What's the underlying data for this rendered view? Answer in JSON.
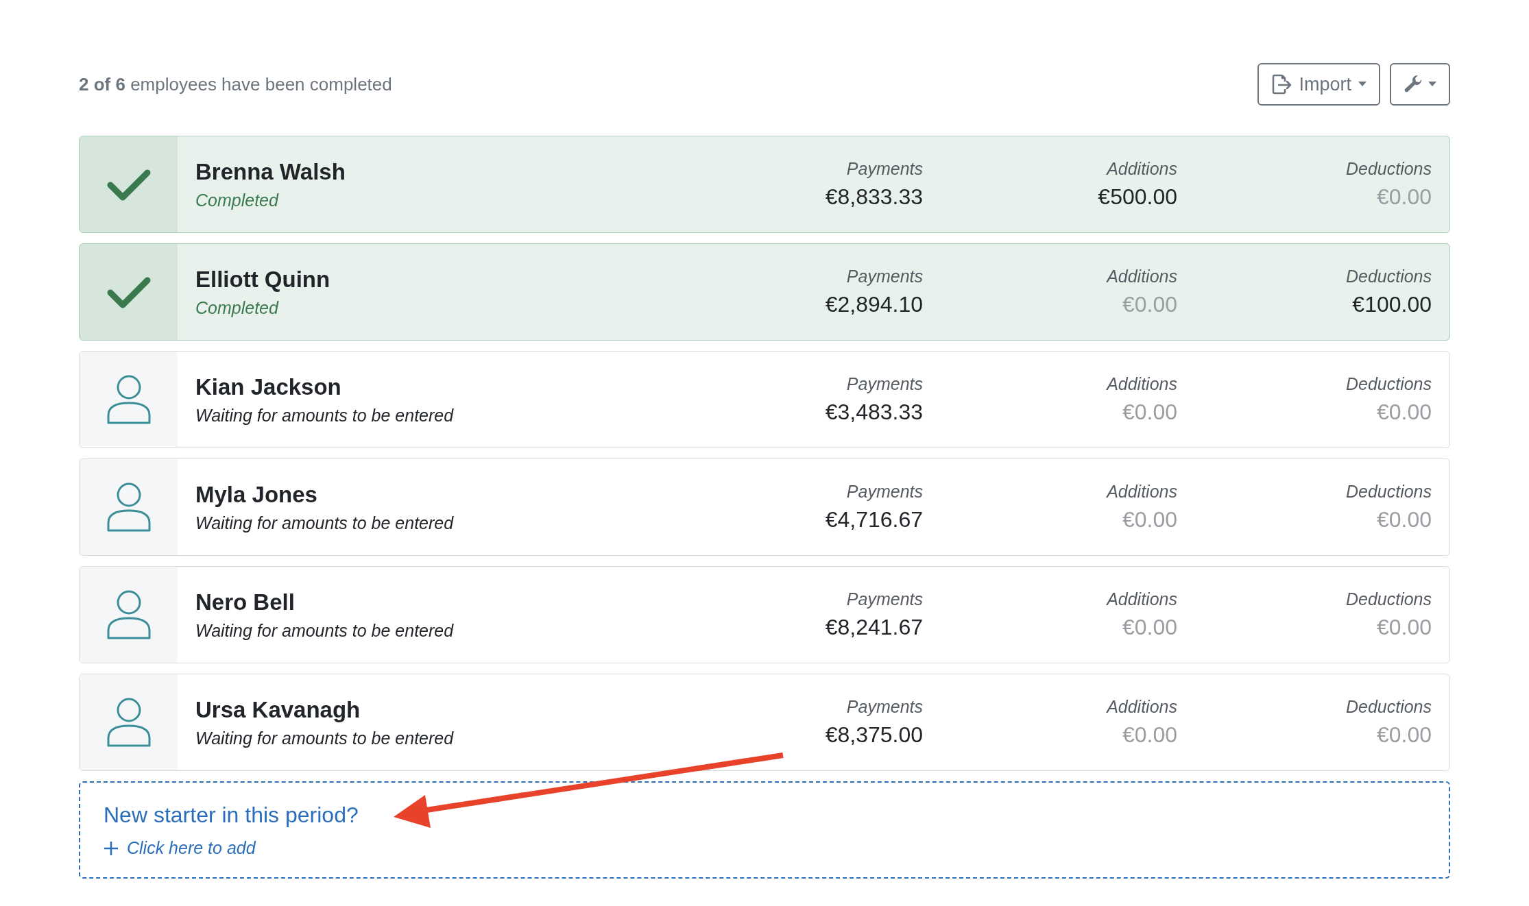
{
  "summary": {
    "count": "2 of 6",
    "text": "employees have been completed"
  },
  "toolbar": {
    "import_label": "Import"
  },
  "employees": [
    {
      "name": "Brenna Walsh",
      "completed": true,
      "status": "Completed",
      "amounts": [
        {
          "label": "Payments",
          "value": "€8,833.33",
          "dimmed": false
        },
        {
          "label": "Additions",
          "value": "€500.00",
          "dimmed": false
        },
        {
          "label": "Deductions",
          "value": "€0.00",
          "dimmed": true
        }
      ]
    },
    {
      "name": "Elliott Quinn",
      "completed": true,
      "status": "Completed",
      "amounts": [
        {
          "label": "Payments",
          "value": "€2,894.10",
          "dimmed": false
        },
        {
          "label": "Additions",
          "value": "€0.00",
          "dimmed": true
        },
        {
          "label": "Deductions",
          "value": "€100.00",
          "dimmed": false
        }
      ]
    },
    {
      "name": "Kian Jackson",
      "completed": false,
      "status": "Waiting for amounts to be entered",
      "amounts": [
        {
          "label": "Payments",
          "value": "€3,483.33",
          "dimmed": false
        },
        {
          "label": "Additions",
          "value": "€0.00",
          "dimmed": true
        },
        {
          "label": "Deductions",
          "value": "€0.00",
          "dimmed": true
        }
      ]
    },
    {
      "name": "Myla Jones",
      "completed": false,
      "status": "Waiting for amounts to be entered",
      "amounts": [
        {
          "label": "Payments",
          "value": "€4,716.67",
          "dimmed": false
        },
        {
          "label": "Additions",
          "value": "€0.00",
          "dimmed": true
        },
        {
          "label": "Deductions",
          "value": "€0.00",
          "dimmed": true
        }
      ]
    },
    {
      "name": "Nero Bell",
      "completed": false,
      "status": "Waiting for amounts to be entered",
      "amounts": [
        {
          "label": "Payments",
          "value": "€8,241.67",
          "dimmed": false
        },
        {
          "label": "Additions",
          "value": "€0.00",
          "dimmed": true
        },
        {
          "label": "Deductions",
          "value": "€0.00",
          "dimmed": true
        }
      ]
    },
    {
      "name": "Ursa Kavanagh",
      "completed": false,
      "status": "Waiting for amounts to be entered",
      "amounts": [
        {
          "label": "Payments",
          "value": "€8,375.00",
          "dimmed": false
        },
        {
          "label": "Additions",
          "value": "€0.00",
          "dimmed": true
        },
        {
          "label": "Deductions",
          "value": "€0.00",
          "dimmed": true
        }
      ]
    }
  ],
  "new_starter": {
    "title": "New starter in this period?",
    "action": "Click here to add"
  }
}
